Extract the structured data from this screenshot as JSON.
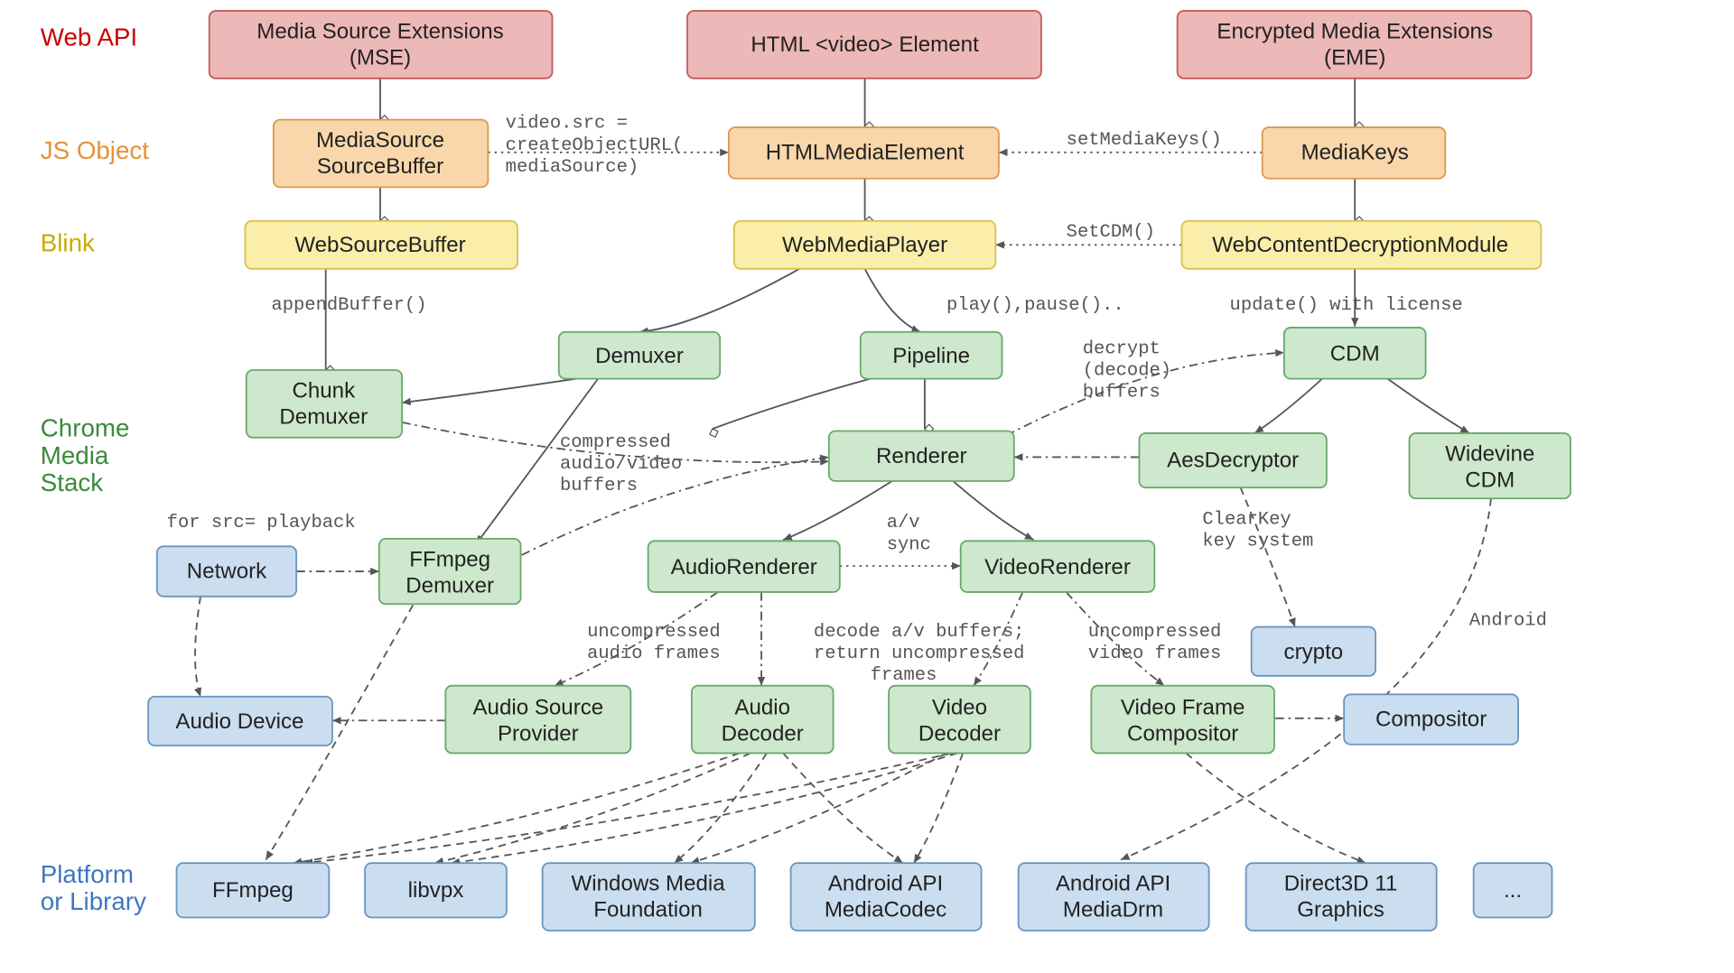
{
  "rows": {
    "webapi": {
      "label": "Web API",
      "color": "#cc0000"
    },
    "jsobject": {
      "label": "JS Object",
      "color": "#e69138"
    },
    "blink": {
      "label": "Blink",
      "color": "#d9b800"
    },
    "stack1": {
      "label": "Chrome",
      "color": "#3a8a3a"
    },
    "stack2": {
      "label": "Media",
      "color": "#3a8a3a"
    },
    "stack3": {
      "label": "Stack",
      "color": "#3a8a3a"
    },
    "plat1": {
      "label": "Platform",
      "color": "#3d77c2"
    },
    "plat2": {
      "label": "or Library",
      "color": "#3d77c2"
    }
  },
  "colors": {
    "red": {
      "fill": "#ecb8b8",
      "stroke": "#c55a5a"
    },
    "orange": {
      "fill": "#f9d7ab",
      "stroke": "#d99a4e"
    },
    "yellow": {
      "fill": "#fbeeaa",
      "stroke": "#d6c24e"
    },
    "green": {
      "fill": "#cde8cc",
      "stroke": "#6aa86a"
    },
    "blue": {
      "fill": "#cadef0",
      "stroke": "#6a95c0"
    }
  },
  "boxes": {
    "mse": {
      "lines": [
        "Media Source Extensions",
        "(MSE)"
      ]
    },
    "video": {
      "lines": [
        "HTML <video> Element"
      ]
    },
    "eme": {
      "lines": [
        "Encrypted Media Extensions",
        "(EME)"
      ]
    },
    "msb": {
      "lines": [
        "MediaSource",
        "SourceBuffer"
      ]
    },
    "hme": {
      "lines": [
        "HTMLMediaElement"
      ]
    },
    "mkeys": {
      "lines": [
        "MediaKeys"
      ]
    },
    "wsb": {
      "lines": [
        "WebSourceBuffer"
      ]
    },
    "wmp": {
      "lines": [
        "WebMediaPlayer"
      ]
    },
    "wcdm": {
      "lines": [
        "WebContentDecryptionModule"
      ]
    },
    "chunk": {
      "lines": [
        "Chunk",
        "Demuxer"
      ]
    },
    "demux": {
      "lines": [
        "Demuxer"
      ]
    },
    "pipeline": {
      "lines": [
        "Pipeline"
      ]
    },
    "cdm": {
      "lines": [
        "CDM"
      ]
    },
    "renderer": {
      "lines": [
        "Renderer"
      ]
    },
    "aesdec": {
      "lines": [
        "AesDecryptor"
      ]
    },
    "widevine": {
      "lines": [
        "Widevine",
        "CDM"
      ]
    },
    "network": {
      "lines": [
        "Network"
      ]
    },
    "ffdemux": {
      "lines": [
        "FFmpeg",
        "Demuxer"
      ]
    },
    "arender": {
      "lines": [
        "AudioRenderer"
      ]
    },
    "vrender": {
      "lines": [
        "VideoRenderer"
      ]
    },
    "crypto": {
      "lines": [
        "crypto"
      ]
    },
    "adevice": {
      "lines": [
        "Audio Device"
      ]
    },
    "asp": {
      "lines": [
        "Audio Source",
        "Provider"
      ]
    },
    "adecoder": {
      "lines": [
        "Audio",
        "Decoder"
      ]
    },
    "vdecoder": {
      "lines": [
        "Video",
        "Decoder"
      ]
    },
    "vfc": {
      "lines": [
        "Video Frame",
        "Compositor"
      ]
    },
    "comp": {
      "lines": [
        "Compositor"
      ]
    },
    "ffmpeg": {
      "lines": [
        "FFmpeg"
      ]
    },
    "libvpx": {
      "lines": [
        "libvpx"
      ]
    },
    "wmf": {
      "lines": [
        "Windows Media",
        "Foundation"
      ]
    },
    "amc": {
      "lines": [
        "Android API",
        "MediaCodec"
      ]
    },
    "amd": {
      "lines": [
        "Android API",
        "MediaDrm"
      ]
    },
    "d3d": {
      "lines": [
        "Direct3D 11",
        "Graphics"
      ]
    },
    "more": {
      "lines": [
        "..."
      ]
    }
  },
  "ann": {
    "createurl1": "video.src =",
    "createurl2": "createObjectURL(",
    "createurl3": "mediaSource)",
    "setmediakeys": "setMediaKeys()",
    "setcdm": "SetCDM()",
    "appendbuf": "appendBuffer()",
    "playpause": "play(),pause()..",
    "updatelic": "update() with license",
    "cabuf1": "compressed",
    "cabuf2": "audio/video",
    "cabuf3": "buffers",
    "decrypt1": "decrypt",
    "decrypt2": "(decode)",
    "decrypt3": "buffers",
    "forsrc": "for src= playback",
    "avsync1": "a/v",
    "avsync2": "sync",
    "clearkey1": "ClearKey",
    "clearkey2": "key system",
    "android": "Android",
    "uaf1": "uncompressed",
    "uaf2": "audio frames",
    "dab1": "decode a/v buffers;",
    "dab2": "return uncompressed",
    "dab3": "frames",
    "uvf1": "uncompressed",
    "uvf2": "video frames"
  }
}
